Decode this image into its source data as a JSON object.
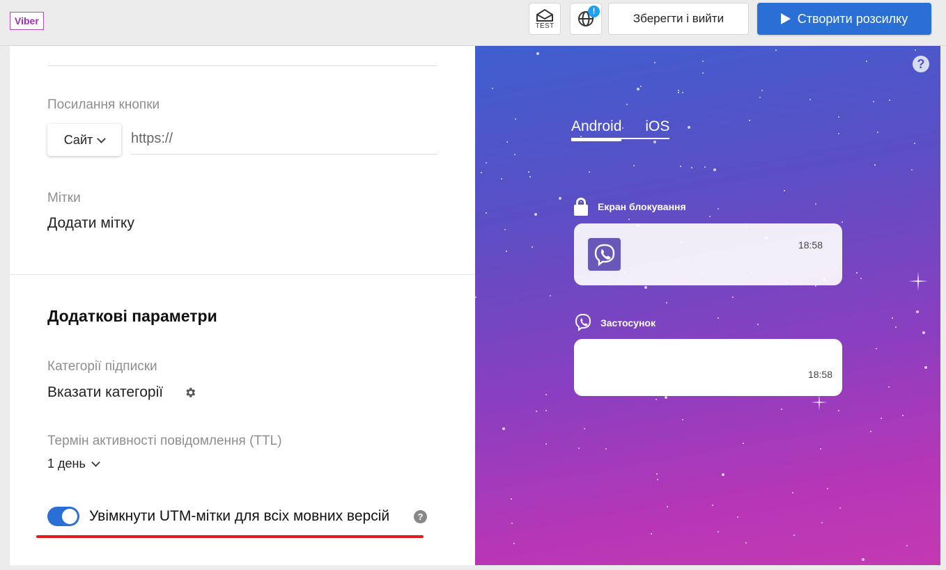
{
  "header": {
    "badge": "Viber",
    "test_label": "TEST",
    "alert": "!",
    "save_label": "Зберегти і вийти",
    "create_label": "Створити розсилку"
  },
  "form": {
    "button_link_label": "Посилання кнопки",
    "link_type": "Сайт",
    "url_placeholder": "https://",
    "tags_label": "Мітки",
    "add_tag": "Додати мітку",
    "extra_title": "Додаткові параметри",
    "categories_label": "Категорії підписки",
    "categories_action": "Вказати категорії",
    "ttl_label": "Термін активності повідомлення (TTL)",
    "ttl_value": "1 день",
    "utm_label": "Увімкнути UTM-мітки для всіх мовних версій",
    "utm_enabled": true,
    "help": "?"
  },
  "preview": {
    "help": "?",
    "tabs": [
      "Android",
      "iOS"
    ],
    "active_tab": "Android",
    "lock_screen_label": "Екран блокування",
    "app_label": "Застосунок",
    "lock_time": "18:58",
    "app_time": "18:58"
  },
  "colors": {
    "accent": "#2a6fd6",
    "underline": "#e21b1b",
    "badge": "#9a2fae"
  }
}
